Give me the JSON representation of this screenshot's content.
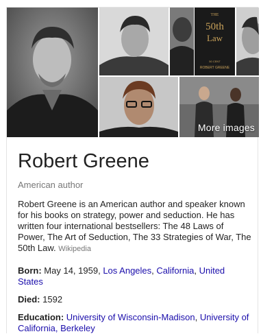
{
  "images": {
    "more_label": "More images",
    "book_cover": {
      "top_text": "THE",
      "title": "50th",
      "title2": "Law",
      "byline": "50 CENT",
      "author": "ROBERT GREENE"
    }
  },
  "entity": {
    "title": "Robert Greene",
    "subtitle": "American author",
    "description": "Robert Greene is an American author and speaker known for his books on strategy, power and seduction. He has written four international bestsellers: The 48 Laws of Power, The Art of Seduction, The 33 Strategies of War, The 50th Law.",
    "source": "Wikipedia"
  },
  "facts": {
    "born": {
      "label": "Born:",
      "date": "May 14, 1959,",
      "place1": "Los Angeles",
      "sep": ",",
      "place2": "California",
      "sep2": ",",
      "place3": "United States"
    },
    "died": {
      "label": "Died:",
      "value": "1592"
    },
    "education": {
      "label": "Education:",
      "link1": "University of Wisconsin-Madison",
      "sep": ",",
      "link2": "University of California, Berkeley"
    }
  }
}
